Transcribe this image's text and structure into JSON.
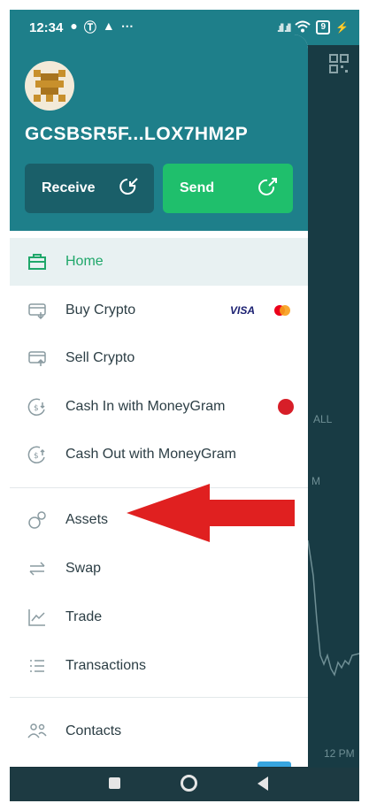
{
  "status_bar": {
    "time": "12:34",
    "icons": [
      "location-icon",
      "b-icon",
      "warning-icon",
      "more-icon"
    ],
    "battery": "9"
  },
  "background_app": {
    "label_all": "ALL",
    "label_m": "M",
    "label_time": "12 PM"
  },
  "drawer": {
    "account_id": "GCSBSR5F...LOX7HM2P",
    "receive_label": "Receive",
    "send_label": "Send",
    "menu": [
      {
        "label": "Home",
        "icon": "briefcase-icon",
        "active": true
      },
      {
        "label": "Buy Crypto",
        "icon": "card-in-icon",
        "badge": "VISA"
      },
      {
        "label": "Sell Crypto",
        "icon": "card-out-icon"
      },
      {
        "label": "Cash In with MoneyGram",
        "icon": "cash-in-icon"
      },
      {
        "label": "Cash Out with MoneyGram",
        "icon": "cash-out-icon"
      },
      {
        "label": "Assets",
        "icon": "assets-icon"
      },
      {
        "label": "Swap",
        "icon": "swap-icon"
      },
      {
        "label": "Trade",
        "icon": "chart-icon"
      },
      {
        "label": "Transactions",
        "icon": "list-icon"
      },
      {
        "label": "Contacts",
        "icon": "contacts-icon"
      }
    ]
  },
  "colors": {
    "teal": "#1e7f8a",
    "green": "#1fbf6c",
    "active_text": "#1fa76a",
    "annotation_arrow": "#e02020"
  }
}
